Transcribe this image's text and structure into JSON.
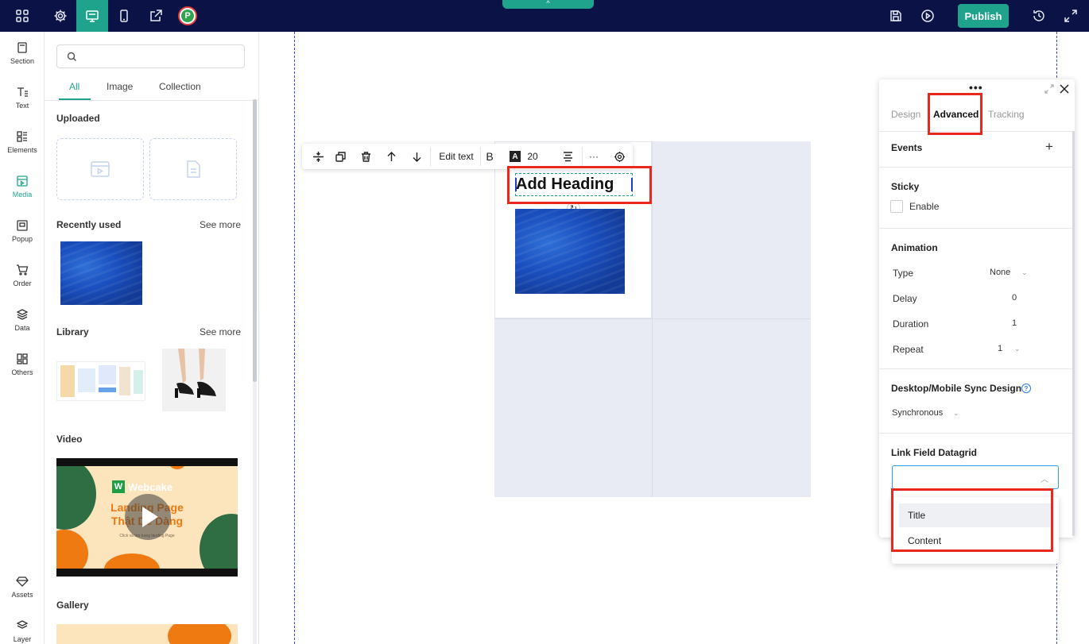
{
  "topbar": {
    "icons": [
      "apps-grid-icon",
      "settings-gear-icon",
      "desktop-icon",
      "mobile-icon",
      "share-icon",
      "brand-logo"
    ],
    "brand_letter": "P",
    "publish_label": "Publish",
    "accent_color": "#1fa38d",
    "bar_color": "#0b1245"
  },
  "rail": {
    "items": [
      {
        "label": "Section"
      },
      {
        "label": "Text"
      },
      {
        "label": "Elements"
      },
      {
        "label": "Media"
      },
      {
        "label": "Popup"
      },
      {
        "label": "Order"
      },
      {
        "label": "Data"
      },
      {
        "label": "Others"
      },
      {
        "label": "Assets"
      },
      {
        "label": "Layer"
      }
    ],
    "active": "Media"
  },
  "media_panel": {
    "search_placeholder": "",
    "tabs": [
      "All",
      "Image",
      "Collection"
    ],
    "active_tab": "All",
    "uploaded_title": "Uploaded",
    "recently_used_title": "Recently used",
    "library_title": "Library",
    "see_more_label": "See more",
    "video_title": "Video",
    "gallery_title": "Gallery",
    "video": {
      "brand": "Webcake",
      "brand_letter": "W",
      "line1": "Landing Page",
      "line2": "Thật Dễ Dàng",
      "sub": "Click và tạo trang landing Page"
    }
  },
  "toolbar": {
    "edit_text_label": "Edit text",
    "bold_label": "B",
    "font_icon_label": "A",
    "font_size": "20",
    "more_label": "···"
  },
  "canvas": {
    "heading_text": "Add Heading"
  },
  "properties": {
    "tabs": [
      "Design",
      "Advanced",
      "Tracking"
    ],
    "active_tab": "Advanced",
    "events_title": "Events",
    "events_add": "+",
    "sticky_title": "Sticky",
    "sticky_enable_label": "Enable",
    "sticky_enabled": false,
    "animation_title": "Animation",
    "animation": {
      "type_label": "Type",
      "type_value": "None",
      "delay_label": "Delay",
      "delay_value": "0",
      "duration_label": "Duration",
      "duration_value": "1",
      "repeat_label": "Repeat",
      "repeat_value": "1"
    },
    "sync_title": "Desktop/Mobile Sync Design",
    "sync_help": "?",
    "sync_value": "Synchronous",
    "link_field_title": "Link Field Datagrid",
    "link_field_value": "",
    "dropdown_options": [
      "Title",
      "Content"
    ],
    "hovered_option": "Title"
  },
  "annotations": {
    "highlight_color": "#e8281d"
  }
}
